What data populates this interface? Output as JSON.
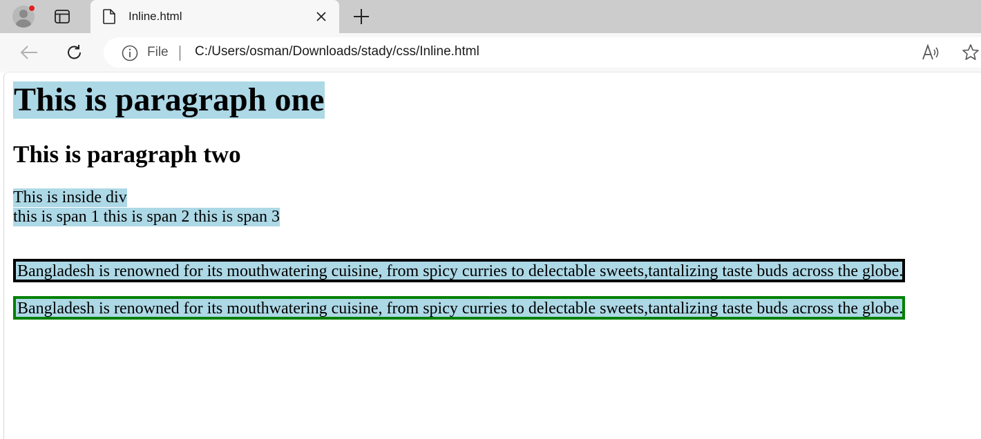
{
  "tab": {
    "title": "Inline.html"
  },
  "addressbar": {
    "scheme_label": "File",
    "url": "C:/Users/osman/Downloads/stady/css/Inline.html"
  },
  "icons": [
    "profile-avatar-icon",
    "tab-actions-icon",
    "file-icon",
    "close-icon",
    "plus-icon",
    "back-arrow-icon",
    "refresh-icon",
    "info-icon",
    "read-aloud-icon",
    "star-icon"
  ],
  "page": {
    "heading_one": "This is paragraph one",
    "heading_two": "This is paragraph two",
    "div_text": "This is inside div",
    "span1": "this is span 1",
    "span2": "this is span 2",
    "span3": "this is span 3",
    "paragraph_black_border": "Bangladesh is renowned for its mouthwatering cuisine, from spicy curries to delectable sweets,tantalizing taste buds across the globe.",
    "paragraph_green_border": "Bangladesh is renowned for its mouthwatering cuisine, from spicy curries to delectable sweets,tantalizing taste buds across the globe."
  },
  "colors": {
    "highlight": "#add8e6",
    "border_one": "#000000",
    "border_two": "#008000",
    "notification_dot": "#e02020"
  }
}
